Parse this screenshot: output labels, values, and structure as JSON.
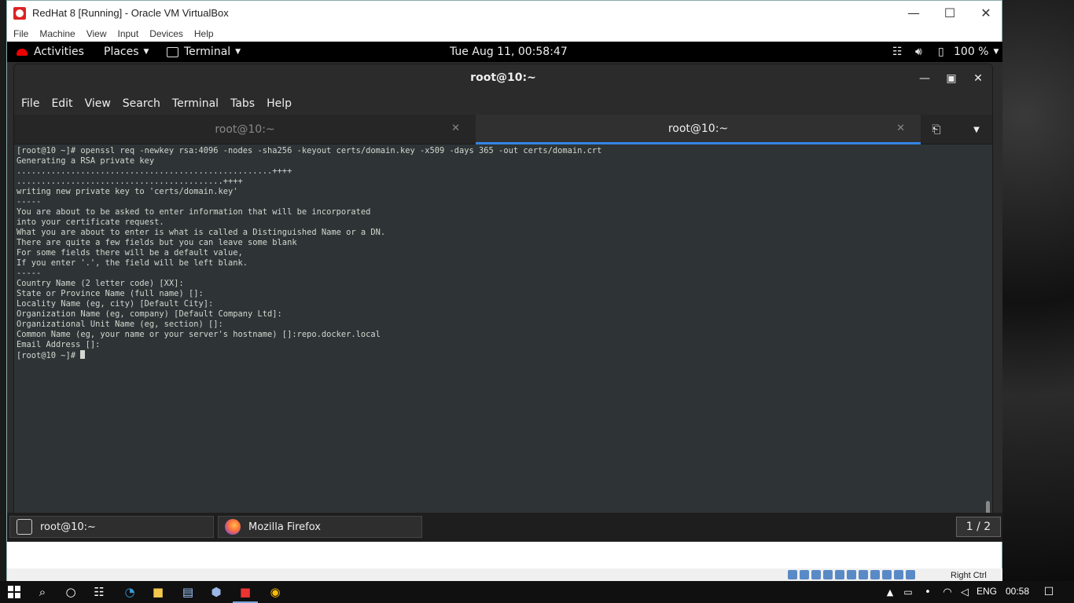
{
  "vbox": {
    "title": "RedHat 8 [Running] - Oracle VM VirtualBox",
    "menu": [
      "File",
      "Machine",
      "View",
      "Input",
      "Devices",
      "Help"
    ],
    "host_key": "Right Ctrl"
  },
  "gnome": {
    "activities": "Activities",
    "places": "Places",
    "terminal_app": "Terminal",
    "clock": "Tue Aug 11, 00:58:47",
    "battery": "100 %"
  },
  "terminal": {
    "title": "root@10:~",
    "menu": [
      "File",
      "Edit",
      "View",
      "Search",
      "Terminal",
      "Tabs",
      "Help"
    ],
    "tabs": [
      {
        "label": "root@10:~",
        "active": false
      },
      {
        "label": "root@10:~",
        "active": true
      }
    ],
    "output_lines": [
      "[root@10 ~]# openssl req -newkey rsa:4096 -nodes -sha256 -keyout certs/domain.key -x509 -days 365 -out certs/domain.crt",
      "Generating a RSA private key",
      "....................................................++++",
      "..........................................++++",
      "writing new private key to 'certs/domain.key'",
      "-----",
      "You are about to be asked to enter information that will be incorporated",
      "into your certificate request.",
      "What you are about to enter is what is called a Distinguished Name or a DN.",
      "There are quite a few fields but you can leave some blank",
      "For some fields there will be a default value,",
      "If you enter '.', the field will be left blank.",
      "-----",
      "Country Name (2 letter code) [XX]:",
      "State or Province Name (full name) []:",
      "Locality Name (eg, city) [Default City]:",
      "Organization Name (eg, company) [Default Company Ltd]:",
      "Organizational Unit Name (eg, section) []:",
      "Common Name (eg, your name or your server's hostname) []:repo.docker.local",
      "Email Address []:"
    ],
    "prompt": "[root@10 ~]# "
  },
  "window_list": {
    "items": [
      "root@10:~",
      "Mozilla Firefox"
    ],
    "workspace": "1 / 2"
  },
  "taskbar": {
    "lang": "ENG",
    "time": "00:58"
  }
}
